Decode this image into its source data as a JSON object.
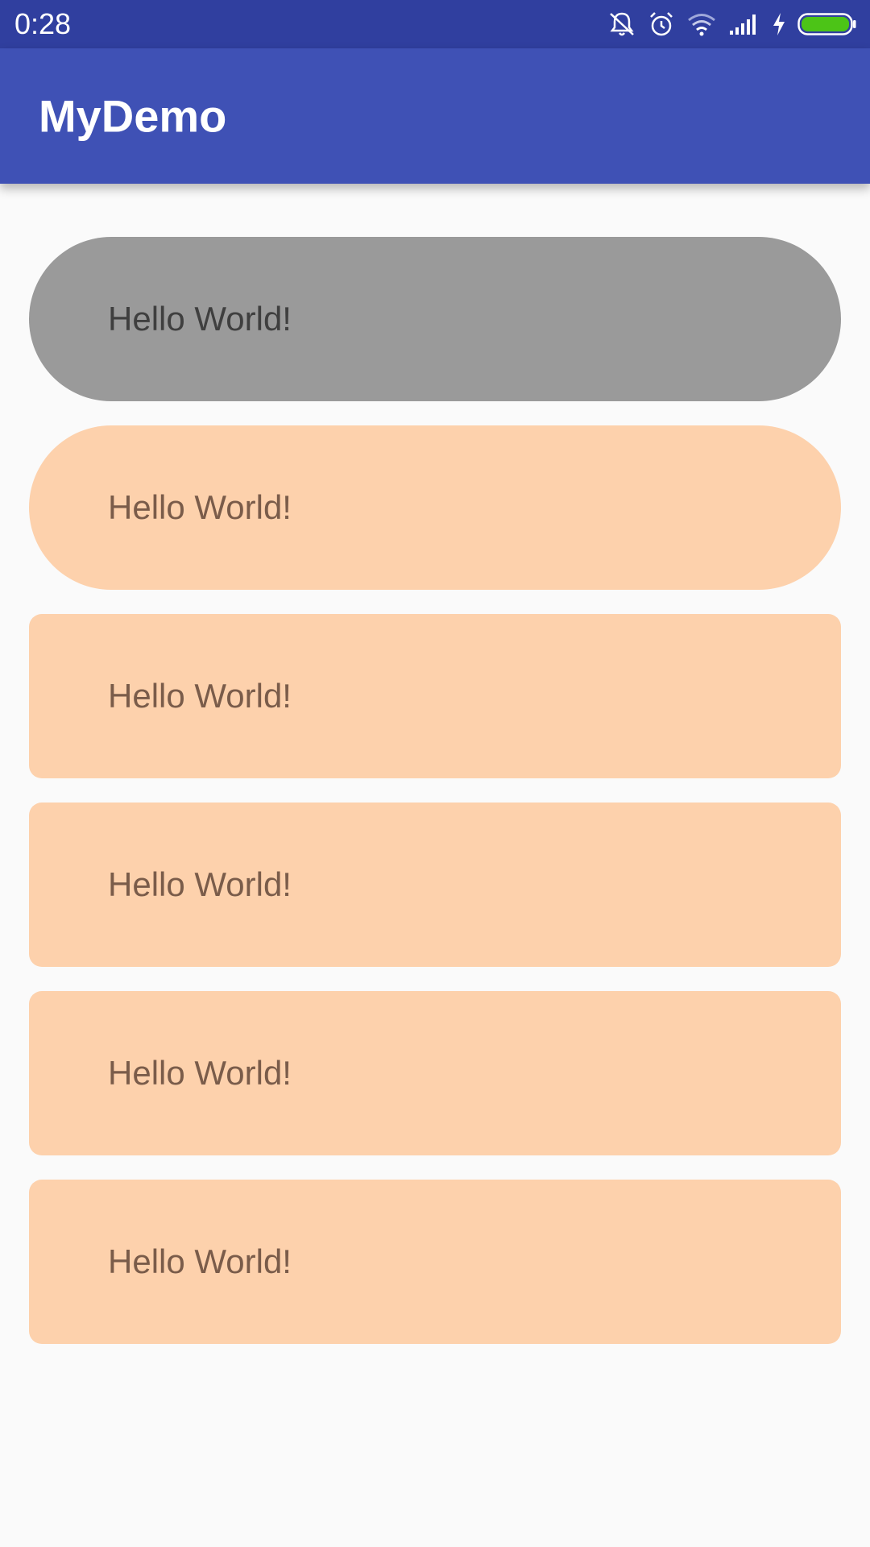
{
  "status_bar": {
    "time": "0:28",
    "icons": [
      "bell-off-icon",
      "alarm-icon",
      "wifi-icon",
      "signal-icon",
      "charging-icon",
      "battery-icon"
    ],
    "battery_color": "#4cc417"
  },
  "app_bar": {
    "title": "MyDemo",
    "color": "#3f51b5"
  },
  "items": [
    {
      "label": "Hello World!",
      "shape": "pill",
      "color": "#9a9a9a"
    },
    {
      "label": "Hello World!",
      "shape": "pill",
      "color": "#fdd1ac"
    },
    {
      "label": "Hello World!",
      "shape": "rounded",
      "color": "#fdd1ac"
    },
    {
      "label": "Hello World!",
      "shape": "rounded",
      "color": "#fdd1ac"
    },
    {
      "label": "Hello World!",
      "shape": "rounded",
      "color": "#fdd1ac"
    },
    {
      "label": "Hello World!",
      "shape": "rounded",
      "color": "#fdd1ac"
    }
  ]
}
